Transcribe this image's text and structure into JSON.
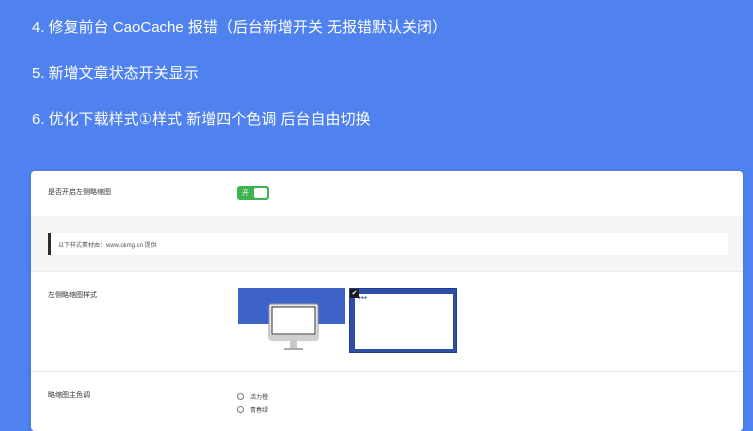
{
  "notes": [
    "4.  修复前台 CaoCache 报错（后台新增开关 无报错默认关闭）",
    "5.  新增文章状态开关显示",
    "6.  优化下载样式①样式  新增四个色调 后台自由切换"
  ],
  "settings": {
    "thumbnail_toggle": {
      "label": "是否开启左侧略缩图",
      "state_text": "开",
      "on": true
    },
    "notice": {
      "text": "以下样式素材由：www.okmg.cn 提供"
    },
    "thumbnail_style": {
      "label": "左侧略缩图样式",
      "selected_index": 1
    },
    "thumbnail_color": {
      "label": "略缩图主色调",
      "options": [
        "活力橙",
        "青春绿"
      ]
    }
  },
  "colors": {
    "background": "#4f82ee",
    "toggle_on": "#3fb34f",
    "thumb_blue": "#3d63c9"
  }
}
